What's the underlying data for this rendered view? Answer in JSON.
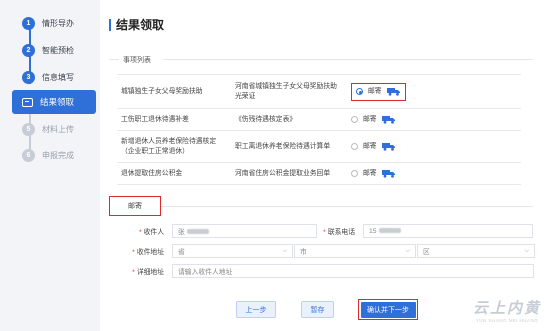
{
  "sidebar": {
    "steps": [
      {
        "num": "1",
        "label": "情形导办",
        "state": "done"
      },
      {
        "num": "2",
        "label": "智能预检",
        "state": "done"
      },
      {
        "num": "3",
        "label": "信息填写",
        "state": "done"
      },
      {
        "num": "",
        "label": "结果领取",
        "state": "active"
      },
      {
        "num": "5",
        "label": "材料上传",
        "state": "todo"
      },
      {
        "num": "6",
        "label": "申报完成",
        "state": "todo"
      }
    ]
  },
  "main": {
    "title": "结果领取",
    "items_section_label": "事项列表",
    "items": [
      {
        "name": "城镇独生子女父母奖励扶助",
        "result": "河南省城镇独生子女父母奖励扶助光荣证",
        "method": "邮寄",
        "selected": true
      },
      {
        "name": "工伤职工退休待遇补差",
        "result": "《伤残待遇核定表》",
        "method": "邮寄",
        "selected": false
      },
      {
        "name": "新增退休人员养老保险待遇核定（企业职工正常退休）",
        "result": "职工离退休养老保险待遇计算单",
        "method": "邮寄",
        "selected": false
      },
      {
        "name": "退休提取住房公积金",
        "result": "河南省住房公积金提取业务回单",
        "method": "邮寄",
        "selected": false
      }
    ],
    "mail_tab_label": "邮寄",
    "form": {
      "recipient_label": "收件人",
      "recipient_value": "张",
      "phone_label": "联系电话",
      "phone_value": "15",
      "address_label": "收件地址",
      "province_placeholder": "省",
      "city_placeholder": "市",
      "district_placeholder": "区",
      "detail_label": "详细地址",
      "detail_placeholder": "请输入收件人地址"
    },
    "buttons": {
      "prev": "上一步",
      "save": "暂存",
      "next": "确认并下一步"
    }
  },
  "watermark": {
    "big": "云上内黄",
    "small": "YUN SHANG NEI HUANG"
  },
  "colors": {
    "accent": "#2f6fd8",
    "highlight": "#e02a2a",
    "sidebar_bg": "#f2f4f8"
  }
}
